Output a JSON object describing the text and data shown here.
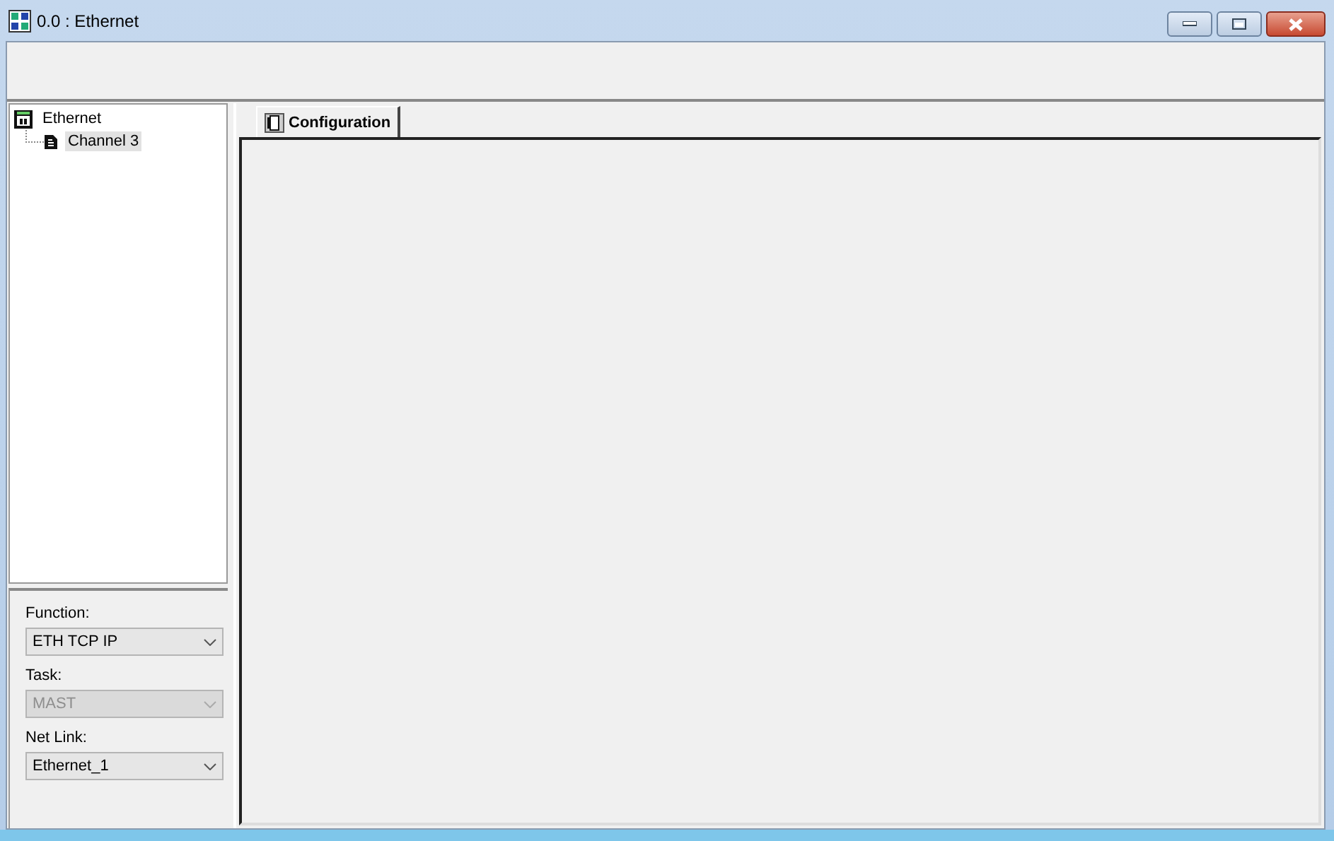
{
  "window": {
    "title": "0.0 : Ethernet"
  },
  "tree": [
    {
      "label": "Ethernet",
      "selected": false,
      "children": [
        {
          "label": "Channel 3",
          "selected": true
        }
      ]
    }
  ],
  "form": [
    {
      "label": "Function:",
      "value": "ETH TCP IP",
      "disabled": false
    },
    {
      "label": "Task:",
      "value": "MAST",
      "disabled": true
    },
    {
      "label": "Net Link:",
      "value": "Ethernet_1",
      "disabled": false
    }
  ],
  "tabs": [
    {
      "label": "Configuration",
      "selected": true
    }
  ]
}
